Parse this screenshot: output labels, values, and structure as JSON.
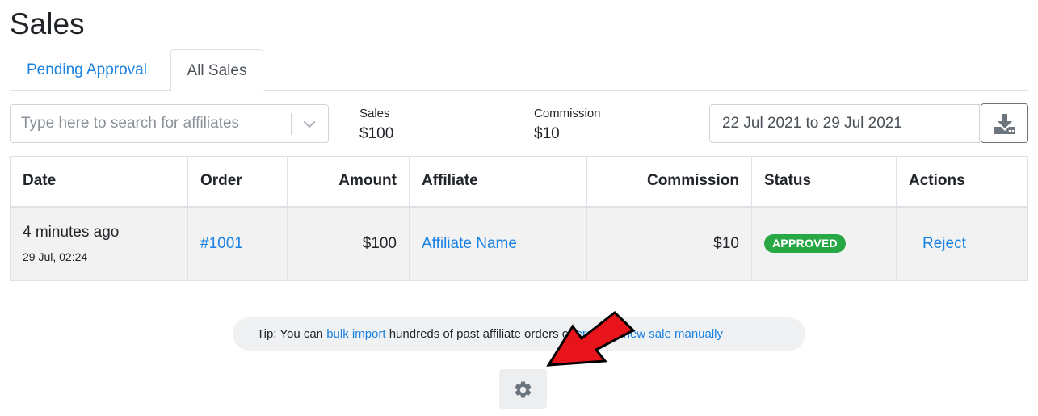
{
  "page": {
    "title": "Sales"
  },
  "tabs": [
    {
      "label": "Pending Approval",
      "active": false
    },
    {
      "label": "All Sales",
      "active": true
    }
  ],
  "search": {
    "placeholder": "Type here to search for affiliates",
    "value": ""
  },
  "stats": {
    "sales_label": "Sales",
    "sales_value": "$100",
    "commission_label": "Commission",
    "commission_value": "$10"
  },
  "date_range": {
    "value": "22 Jul 2021 to 29 Jul 2021"
  },
  "icons": {
    "download": "download-icon",
    "dropdown": "chevron-down-icon",
    "settings": "gear-icon",
    "annotation": "red-arrow-annotation"
  },
  "table": {
    "headers": {
      "date": "Date",
      "order": "Order",
      "amount": "Amount",
      "affiliate": "Affiliate",
      "commission": "Commission",
      "status": "Status",
      "actions": "Actions"
    },
    "rows": [
      {
        "date_relative": "4 minutes ago",
        "date_exact": "29 Jul, 02:24",
        "order": "#1001",
        "amount": "$100",
        "affiliate": "Affiliate Name",
        "commission": "$10",
        "status": "APPROVED",
        "action": "Reject"
      }
    ]
  },
  "tip": {
    "prefix": "Tip: You can ",
    "link1": "bulk import",
    "middle": " hundreds of past affiliate orders or ",
    "link2": "create a new sale manually"
  },
  "colors": {
    "link": "#1a82e2",
    "approved_badge": "#28a745",
    "arrow": "#e8141b"
  }
}
